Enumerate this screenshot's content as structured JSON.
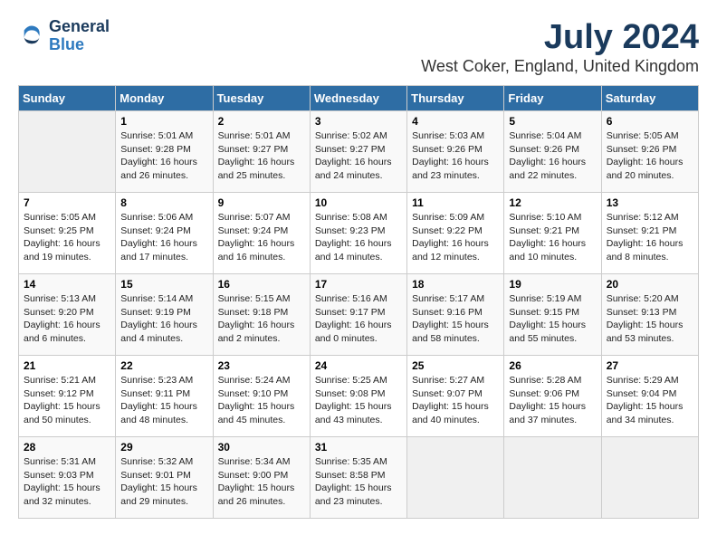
{
  "logo": {
    "line1": "General",
    "line2": "Blue"
  },
  "title": "July 2024",
  "subtitle": "West Coker, England, United Kingdom",
  "days_of_week": [
    "Sunday",
    "Monday",
    "Tuesday",
    "Wednesday",
    "Thursday",
    "Friday",
    "Saturday"
  ],
  "weeks": [
    [
      {
        "day": "",
        "info": ""
      },
      {
        "day": "1",
        "info": "Sunrise: 5:01 AM\nSunset: 9:28 PM\nDaylight: 16 hours\nand 26 minutes."
      },
      {
        "day": "2",
        "info": "Sunrise: 5:01 AM\nSunset: 9:27 PM\nDaylight: 16 hours\nand 25 minutes."
      },
      {
        "day": "3",
        "info": "Sunrise: 5:02 AM\nSunset: 9:27 PM\nDaylight: 16 hours\nand 24 minutes."
      },
      {
        "day": "4",
        "info": "Sunrise: 5:03 AM\nSunset: 9:26 PM\nDaylight: 16 hours\nand 23 minutes."
      },
      {
        "day": "5",
        "info": "Sunrise: 5:04 AM\nSunset: 9:26 PM\nDaylight: 16 hours\nand 22 minutes."
      },
      {
        "day": "6",
        "info": "Sunrise: 5:05 AM\nSunset: 9:26 PM\nDaylight: 16 hours\nand 20 minutes."
      }
    ],
    [
      {
        "day": "7",
        "info": "Sunrise: 5:05 AM\nSunset: 9:25 PM\nDaylight: 16 hours\nand 19 minutes."
      },
      {
        "day": "8",
        "info": "Sunrise: 5:06 AM\nSunset: 9:24 PM\nDaylight: 16 hours\nand 17 minutes."
      },
      {
        "day": "9",
        "info": "Sunrise: 5:07 AM\nSunset: 9:24 PM\nDaylight: 16 hours\nand 16 minutes."
      },
      {
        "day": "10",
        "info": "Sunrise: 5:08 AM\nSunset: 9:23 PM\nDaylight: 16 hours\nand 14 minutes."
      },
      {
        "day": "11",
        "info": "Sunrise: 5:09 AM\nSunset: 9:22 PM\nDaylight: 16 hours\nand 12 minutes."
      },
      {
        "day": "12",
        "info": "Sunrise: 5:10 AM\nSunset: 9:21 PM\nDaylight: 16 hours\nand 10 minutes."
      },
      {
        "day": "13",
        "info": "Sunrise: 5:12 AM\nSunset: 9:21 PM\nDaylight: 16 hours\nand 8 minutes."
      }
    ],
    [
      {
        "day": "14",
        "info": "Sunrise: 5:13 AM\nSunset: 9:20 PM\nDaylight: 16 hours\nand 6 minutes."
      },
      {
        "day": "15",
        "info": "Sunrise: 5:14 AM\nSunset: 9:19 PM\nDaylight: 16 hours\nand 4 minutes."
      },
      {
        "day": "16",
        "info": "Sunrise: 5:15 AM\nSunset: 9:18 PM\nDaylight: 16 hours\nand 2 minutes."
      },
      {
        "day": "17",
        "info": "Sunrise: 5:16 AM\nSunset: 9:17 PM\nDaylight: 16 hours\nand 0 minutes."
      },
      {
        "day": "18",
        "info": "Sunrise: 5:17 AM\nSunset: 9:16 PM\nDaylight: 15 hours\nand 58 minutes."
      },
      {
        "day": "19",
        "info": "Sunrise: 5:19 AM\nSunset: 9:15 PM\nDaylight: 15 hours\nand 55 minutes."
      },
      {
        "day": "20",
        "info": "Sunrise: 5:20 AM\nSunset: 9:13 PM\nDaylight: 15 hours\nand 53 minutes."
      }
    ],
    [
      {
        "day": "21",
        "info": "Sunrise: 5:21 AM\nSunset: 9:12 PM\nDaylight: 15 hours\nand 50 minutes."
      },
      {
        "day": "22",
        "info": "Sunrise: 5:23 AM\nSunset: 9:11 PM\nDaylight: 15 hours\nand 48 minutes."
      },
      {
        "day": "23",
        "info": "Sunrise: 5:24 AM\nSunset: 9:10 PM\nDaylight: 15 hours\nand 45 minutes."
      },
      {
        "day": "24",
        "info": "Sunrise: 5:25 AM\nSunset: 9:08 PM\nDaylight: 15 hours\nand 43 minutes."
      },
      {
        "day": "25",
        "info": "Sunrise: 5:27 AM\nSunset: 9:07 PM\nDaylight: 15 hours\nand 40 minutes."
      },
      {
        "day": "26",
        "info": "Sunrise: 5:28 AM\nSunset: 9:06 PM\nDaylight: 15 hours\nand 37 minutes."
      },
      {
        "day": "27",
        "info": "Sunrise: 5:29 AM\nSunset: 9:04 PM\nDaylight: 15 hours\nand 34 minutes."
      }
    ],
    [
      {
        "day": "28",
        "info": "Sunrise: 5:31 AM\nSunset: 9:03 PM\nDaylight: 15 hours\nand 32 minutes."
      },
      {
        "day": "29",
        "info": "Sunrise: 5:32 AM\nSunset: 9:01 PM\nDaylight: 15 hours\nand 29 minutes."
      },
      {
        "day": "30",
        "info": "Sunrise: 5:34 AM\nSunset: 9:00 PM\nDaylight: 15 hours\nand 26 minutes."
      },
      {
        "day": "31",
        "info": "Sunrise: 5:35 AM\nSunset: 8:58 PM\nDaylight: 15 hours\nand 23 minutes."
      },
      {
        "day": "",
        "info": ""
      },
      {
        "day": "",
        "info": ""
      },
      {
        "day": "",
        "info": ""
      }
    ]
  ]
}
